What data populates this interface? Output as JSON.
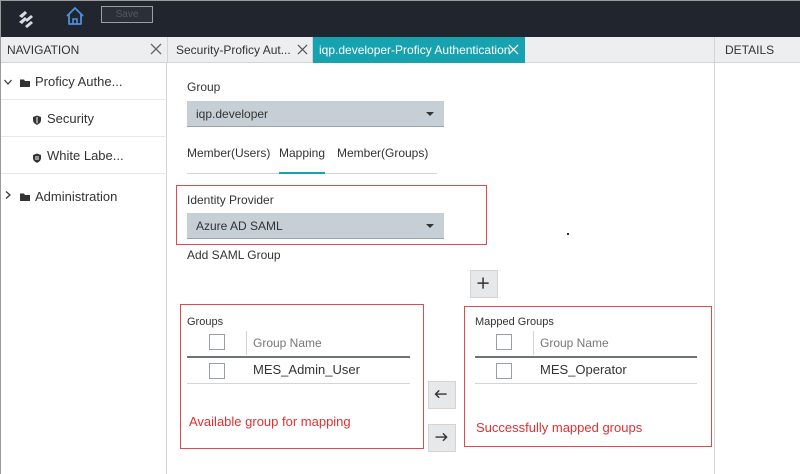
{
  "toolbar": {
    "save_label": "Save"
  },
  "navigation": {
    "title": "NAVIGATION",
    "items": [
      {
        "label": "Proficy Authe...",
        "expanded": true
      },
      {
        "label": "Security"
      },
      {
        "label": "White Labe..."
      },
      {
        "label": "Administration",
        "expanded": false
      }
    ]
  },
  "tabs": [
    {
      "label": "Security-Proficy Aut..."
    },
    {
      "label": "iqp.developer-Proficy Authentication",
      "active": true
    }
  ],
  "details": {
    "title": "DETAILS"
  },
  "form": {
    "group_label": "Group",
    "group_value": "iqp.developer",
    "subtabs": [
      "Member(Users)",
      "Mapping",
      "Member(Groups)"
    ],
    "active_subtab": "Mapping",
    "identity_provider_label": "Identity Provider",
    "identity_provider_value": "Azure AD SAML",
    "add_saml_group_label": "Add SAML Group",
    "add_button": "+"
  },
  "groups_panel": {
    "title": "Groups",
    "column": "Group Name",
    "rows": [
      "MES_Admin_User"
    ],
    "annotation": "Available group for mapping"
  },
  "mapped_panel": {
    "title": "Mapped Groups",
    "column": "Group Name",
    "rows": [
      "MES_Operator"
    ],
    "annotation": "Successfully mapped groups"
  },
  "arrows": {
    "left": "←",
    "right": "→"
  },
  "colors": {
    "accent": "#17a2b0",
    "topbar": "#21262e",
    "annotation": "#e14a4a",
    "select": "#c6cfd6"
  },
  "icons": [
    "app-logo-icon",
    "home-icon",
    "close-icon",
    "chevron-down-icon",
    "chevron-right-icon",
    "folder-icon",
    "shield-icon",
    "shield-tag-icon",
    "plus-icon",
    "arrow-left-icon",
    "arrow-right-icon"
  ]
}
